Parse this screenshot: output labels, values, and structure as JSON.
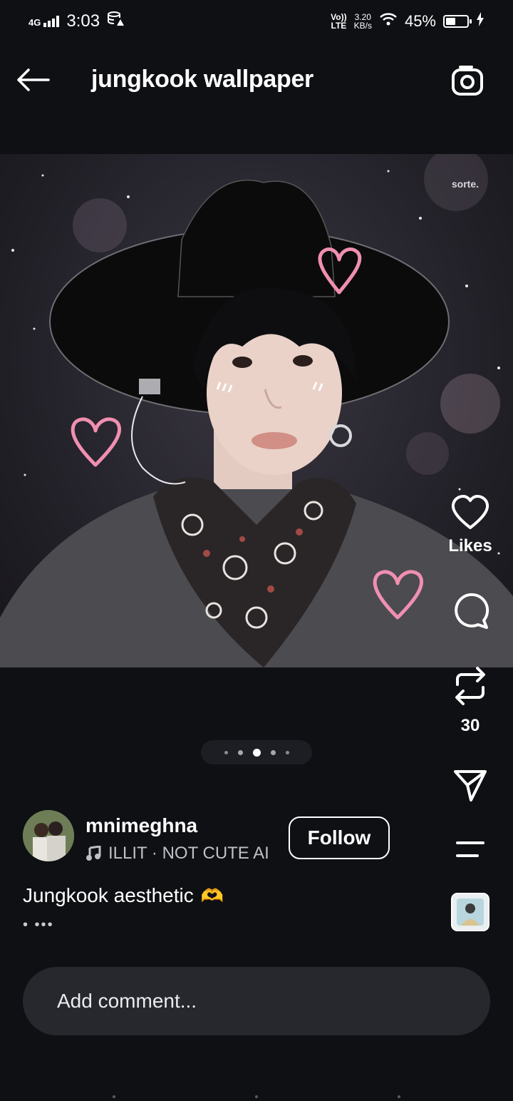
{
  "status_bar": {
    "time": "3:03",
    "network": "4G",
    "volte_top": "Vo))",
    "volte_bottom": "LTE",
    "speed_top": "3.20",
    "speed_bottom": "KB/s",
    "battery_percent": "45%",
    "battery_level": 0.45
  },
  "header": {
    "title": "jungkook wallpaper"
  },
  "photo": {
    "watermark": "sorte."
  },
  "carousel": {
    "total": 5,
    "active_index": 2
  },
  "side_actions": {
    "likes_label": "Likes",
    "reposts_count": "30"
  },
  "author": {
    "username": "mnimeghna",
    "music": "ILLIT · NOT CUTE AI",
    "follow_label": "Follow"
  },
  "caption": {
    "text": "Jungkook aesthetic",
    "emoji": "🫶",
    "more": "• •••"
  },
  "comment": {
    "placeholder": "Add comment..."
  },
  "colors": {
    "background": "#0f1014",
    "comment_box": "#27282e",
    "heart_pink": "#f08fb0"
  }
}
